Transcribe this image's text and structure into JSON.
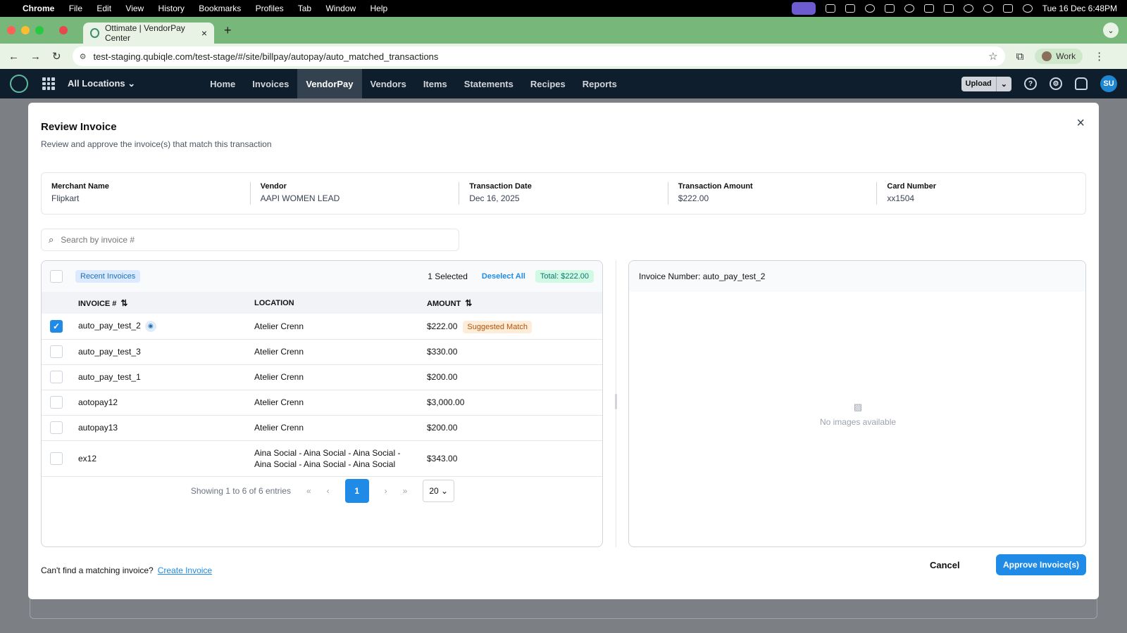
{
  "menubar": {
    "items": [
      "Chrome",
      "File",
      "Edit",
      "View",
      "History",
      "Bookmarks",
      "Profiles",
      "Tab",
      "Window",
      "Help"
    ],
    "clock": "Tue 16 Dec  6:48PM"
  },
  "browser": {
    "tab_title": "Ottimate | VendorPay Center",
    "url": "test-staging.qubiqle.com/test-stage/#/site/billpay/autopay/auto_matched_transactions",
    "profile": "Work"
  },
  "appnav": {
    "location": "All Locations",
    "links": [
      "Home",
      "Invoices",
      "VendorPay",
      "Vendors",
      "Items",
      "Statements",
      "Recipes",
      "Reports"
    ],
    "active": "VendorPay",
    "upload": "Upload",
    "avatar": "SU"
  },
  "modal": {
    "title": "Review Invoice",
    "subtitle": "Review and approve the invoice(s) that match this transaction",
    "info": [
      {
        "label": "Merchant Name",
        "value": "Flipkart"
      },
      {
        "label": "Vendor",
        "value": "AAPI WOMEN LEAD"
      },
      {
        "label": "Transaction Date",
        "value": "Dec 16, 2025"
      },
      {
        "label": "Transaction Amount",
        "value": "$222.00"
      },
      {
        "label": "Card Number",
        "value": "xx1504"
      }
    ],
    "search_placeholder": "Search by invoice #",
    "list": {
      "chip": "Recent Invoices",
      "selected": "1 Selected",
      "deselect": "Deselect All",
      "total": "Total: $222.00",
      "headers": {
        "invoice": "INVOICE #",
        "location": "LOCATION",
        "amount": "AMOUNT"
      },
      "rows": [
        {
          "invoice": "auto_pay_test_2",
          "location": "Atelier Crenn",
          "amount": "$222.00",
          "badge": "Suggested Match"
        },
        {
          "invoice": "auto_pay_test_3",
          "location": "Atelier Crenn",
          "amount": "$330.00"
        },
        {
          "invoice": "auto_pay_test_1",
          "location": "Atelier Crenn",
          "amount": "$200.00"
        },
        {
          "invoice": "aotopay12",
          "location": "Atelier Crenn",
          "amount": "$3,000.00"
        },
        {
          "invoice": "autopay13",
          "location": "Atelier Crenn",
          "amount": "$200.00"
        },
        {
          "invoice": "ex12",
          "location": "Aina Social - Aina Social - Aina Social - Aina Social - Aina Social - Aina Social",
          "amount": "$343.00"
        }
      ],
      "pagination": {
        "showing": "Showing 1 to 6 of 6 entries",
        "page": "1",
        "page_size": "20"
      }
    },
    "preview": {
      "title": "Invoice Number: auto_pay_test_2",
      "empty": "No images available"
    },
    "footer": {
      "prompt": "Can't find a matching invoice?",
      "link": "Create Invoice",
      "cancel": "Cancel",
      "approve": "Approve Invoice(s)"
    }
  }
}
